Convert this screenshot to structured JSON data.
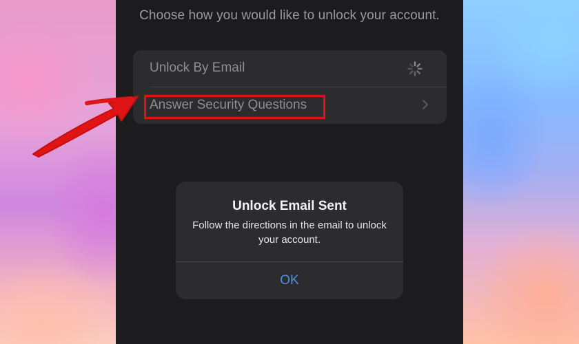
{
  "screen": {
    "instruction": "Choose how you would like to unlock your account."
  },
  "options": [
    {
      "label": "Unlock By Email",
      "status": "loading"
    },
    {
      "label": "Answer Security Questions",
      "icon": "chevron-right-icon"
    }
  ],
  "alert": {
    "title": "Unlock Email Sent",
    "message": "Follow the directions in the email to unlock your account.",
    "button_label": "OK"
  },
  "annotation": {
    "highlight_color": "#e01414",
    "arrow_color": "#e01414"
  },
  "colors": {
    "screen_background": "#1c1c1e",
    "card_background": "#2c2c2e",
    "button_text": "#4a90e2"
  }
}
